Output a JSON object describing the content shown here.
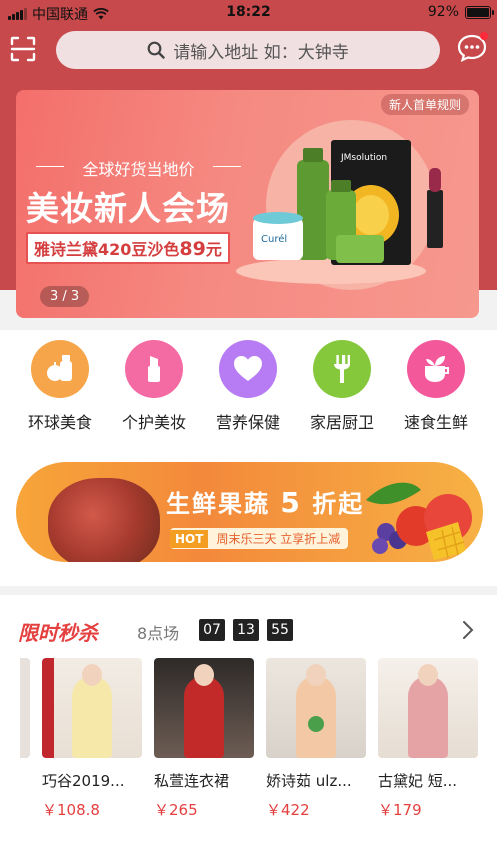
{
  "status_bar": {
    "carrier": "中国联通",
    "time": "18:22",
    "battery": "92%",
    "battery_level": 0.92
  },
  "search": {
    "placeholder": "请输入地址 如：大钟寺"
  },
  "banner": {
    "rule_link": "新人首单规则",
    "slogan": "全球好货当地价",
    "title": "美妆新人会场",
    "promo_prefix": "雅诗兰黛420豆沙色",
    "promo_price": "89",
    "promo_unit": "元",
    "pager": "3 / 3",
    "product_labels": {
      "mask": "JMsolution",
      "cream": "Curél"
    }
  },
  "categories": [
    {
      "label": "环球美食",
      "icon": "fruit-bottle-icon",
      "color": "#f7a54a"
    },
    {
      "label": "个护美妆",
      "icon": "lipstick-icon",
      "color": "#f46aa2"
    },
    {
      "label": "营养保健",
      "icon": "heart-icon",
      "color": "#b77cf3"
    },
    {
      "label": "家居厨卫",
      "icon": "fork-icon",
      "color": "#86c83c"
    },
    {
      "label": "速食生鲜",
      "icon": "cup-plant-icon",
      "color": "#f2589a"
    }
  ],
  "promo_strip": {
    "title_prefix": "生鲜果蔬",
    "title_number": "5",
    "title_suffix": "折起",
    "hot_tag": "HOT",
    "hot_text": "周末乐三天  立享折上减"
  },
  "flash_sale": {
    "title": "限时秒杀",
    "session": "8点场",
    "timer": [
      "07",
      "13",
      "55"
    ],
    "products": [
      {
        "name": "巧谷2019...",
        "price": "￥108.8"
      },
      {
        "name": "私萱连衣裙",
        "price": "￥265"
      },
      {
        "name": "娇诗茹 ulz...",
        "price": "￥422"
      },
      {
        "name": "古黛妃 短...",
        "price": "￥179"
      }
    ]
  }
}
